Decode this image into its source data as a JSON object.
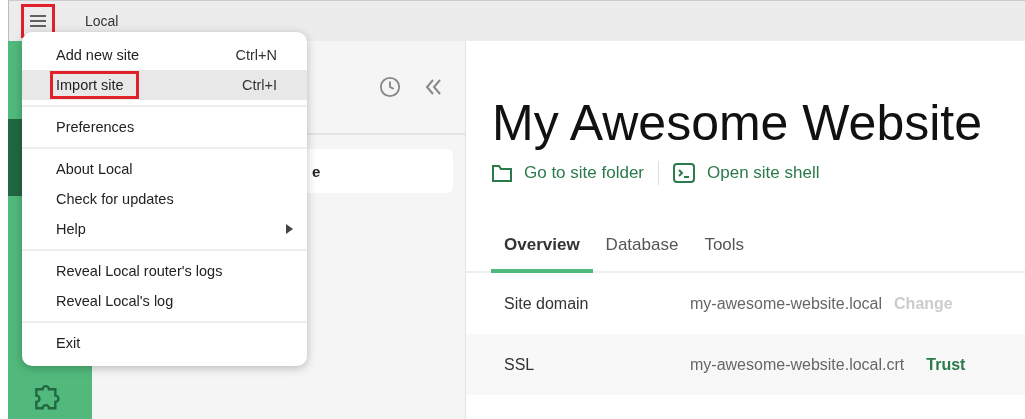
{
  "window": {
    "title": "Local",
    "menu_highlighted": true
  },
  "menu": {
    "items": [
      {
        "kind": "item",
        "label": "Add new site",
        "shortcut": "Ctrl+N",
        "selected": false,
        "highlighted": false
      },
      {
        "kind": "item",
        "label": "Import site",
        "shortcut": "Ctrl+I",
        "selected": true,
        "highlighted": true
      },
      {
        "kind": "divider"
      },
      {
        "kind": "item",
        "label": "Preferences",
        "selected": false,
        "highlighted": false
      },
      {
        "kind": "divider"
      },
      {
        "kind": "item",
        "label": "About Local",
        "selected": false,
        "highlighted": false
      },
      {
        "kind": "item",
        "label": "Check for updates",
        "selected": false,
        "highlighted": false
      },
      {
        "kind": "submenu",
        "label": "Help",
        "selected": false,
        "highlighted": false
      },
      {
        "kind": "divider"
      },
      {
        "kind": "item",
        "label": "Reveal Local router's logs",
        "selected": false,
        "highlighted": false
      },
      {
        "kind": "item",
        "label": "Reveal Local's log",
        "selected": false,
        "highlighted": false
      },
      {
        "kind": "divider"
      },
      {
        "kind": "item",
        "label": "Exit",
        "selected": false,
        "highlighted": false
      }
    ]
  },
  "sidebar": {
    "site": "e"
  },
  "site": {
    "title": "My Awesome Website",
    "actions": [
      {
        "kind": "folder",
        "label": "Go to site folder"
      },
      {
        "kind": "shell",
        "label": "Open site shell"
      }
    ],
    "tabs": [
      {
        "label": "Overview",
        "selected": true
      },
      {
        "label": "Database",
        "selected": false
      },
      {
        "label": "Tools",
        "selected": false
      }
    ],
    "rows": [
      {
        "label": "Site domain",
        "value": "my-awesome-website.local",
        "action": "Change",
        "action_enabled": false
      },
      {
        "label": "SSL",
        "value": "my-awesome-website.local.crt",
        "action": "Trust",
        "action_enabled": true
      }
    ]
  }
}
